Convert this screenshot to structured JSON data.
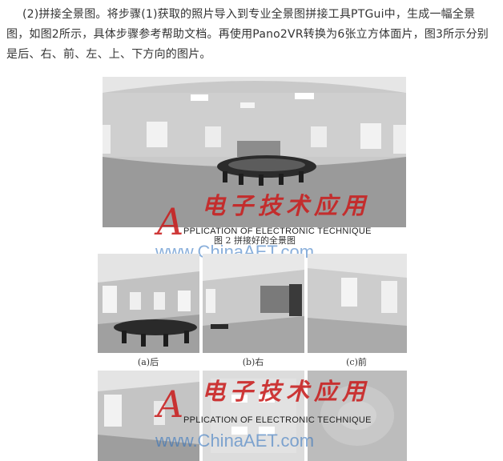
{
  "paragraph": "(2)拼接全景图。将步骤(1)获取的照片导入到专业全景图拼接工具PTGui中，生成一幅全景图，如图2所示，具体步骤参考帮助文档。再使用Pano2VR转换为6张立方体面片，图3所示分别是后、右、前、左、上、下方向的图片。",
  "figure2": {
    "caption": "图 2  拼接好的全景图"
  },
  "figure3": {
    "captions": [
      "(a)后",
      "(b)右",
      "(c)前"
    ]
  },
  "watermark": {
    "chinese": "电子技术应用",
    "english": "PPLICATION OF ELECTRONIC TECHNIQUE",
    "url": "www.ChinaAET.com"
  }
}
